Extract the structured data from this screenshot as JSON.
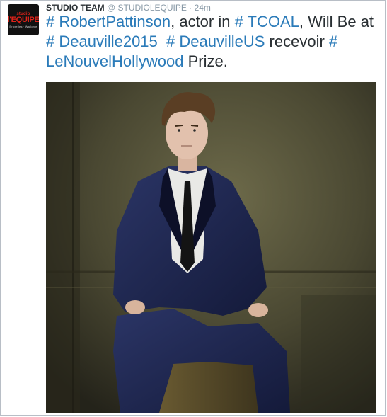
{
  "account": {
    "avatar_text_top": "studio",
    "avatar_text_main": "l'EQUIPE",
    "avatar_text_bottom": "Bruxelles · Wallonie",
    "name": "STUDIO TEAM",
    "handle": "@ STUDIOLEQUIPE",
    "separator": "·",
    "time": "24m"
  },
  "tweet": {
    "t1": "# RobertPattinson",
    "t2": ", actor in ",
    "t3": "# TCOAL",
    "t4": ", Will Be at ",
    "t5": "# Deauville2015",
    "t6": "  ",
    "t7": "# DeauvilleUS",
    "t8": " recevoir ",
    "t9": "# LeNouvelHollywood",
    "t10": " Prize."
  },
  "colors": {
    "link": "#2b7bb9",
    "text": "#292f33",
    "muted": "#8899a6",
    "brand_red": "#e2231a"
  }
}
